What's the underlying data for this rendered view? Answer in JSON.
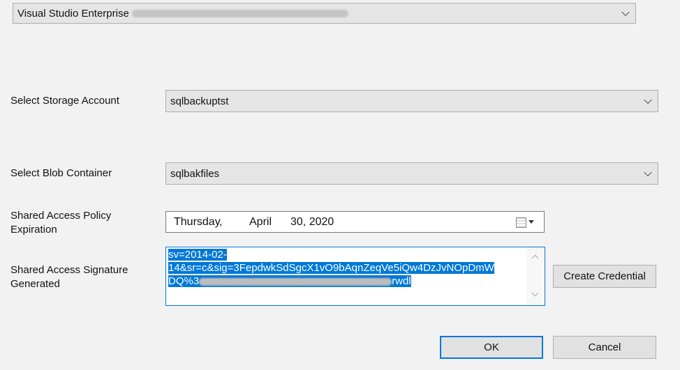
{
  "subscription": {
    "value": "Visual Studio Enterprise",
    "redacted": true
  },
  "storage_account": {
    "label": "Select Storage Account",
    "value": "sqlbackuptst"
  },
  "blob_container": {
    "label": "Select Blob Container",
    "value": "sqlbakfiles"
  },
  "expiration": {
    "label_line1": "Shared Access Policy",
    "label_line2": "Expiration",
    "weekday": "Thursday",
    "sep": ",",
    "month": "April",
    "day_year": "30, 2020",
    "icon": "calendar-icon"
  },
  "signature": {
    "label_line1": "Shared Access Signature",
    "label_line2": "Generated",
    "line1": "sv=2014-02-",
    "line2": "14&sr=c&sig=3FepdwkSdSgcX1vO9bAqnZeqVe5iQw4DzJvNOpDmW",
    "line3_start": "DQ%3",
    "line3_end": "rwdl",
    "selection_color": "#0078d7"
  },
  "buttons": {
    "create_credential": "Create Credential",
    "ok": "OK",
    "cancel": "Cancel"
  }
}
